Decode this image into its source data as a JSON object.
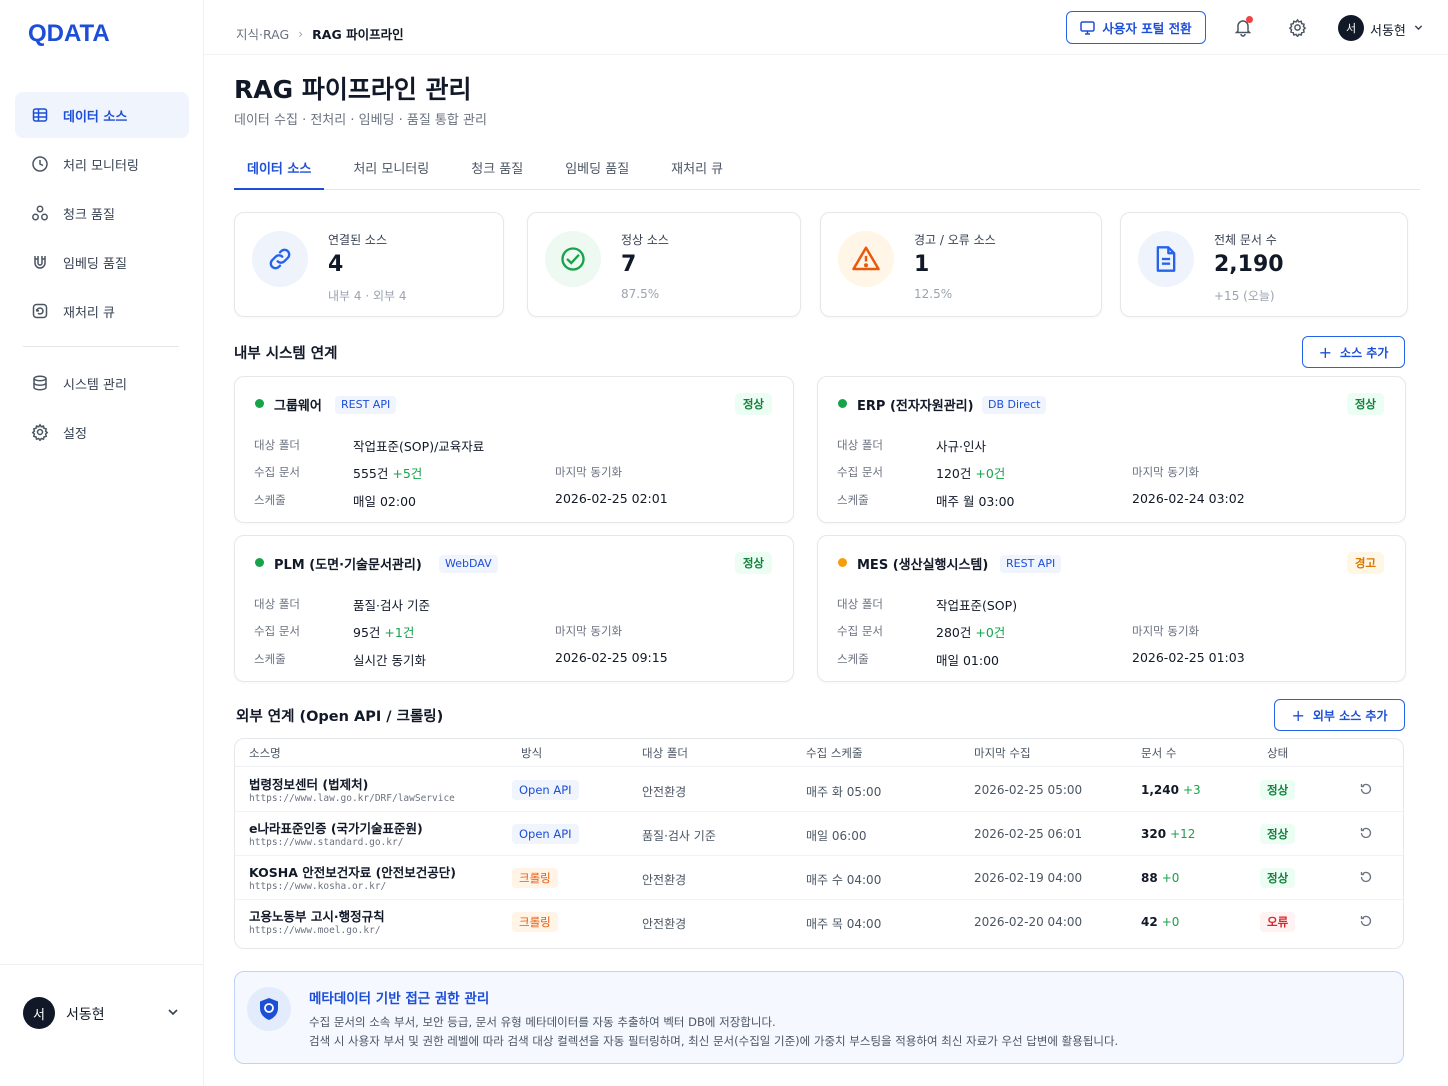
{
  "app": {
    "logo": "QDATA"
  },
  "sidebar": {
    "items": [
      {
        "label": "데이터 소스",
        "icon": "database-grid-icon"
      },
      {
        "label": "처리 모니터링",
        "icon": "clock-icon"
      },
      {
        "label": "청크 품질",
        "icon": "nodes-icon"
      },
      {
        "label": "임베딩 품질",
        "icon": "magnet-icon"
      },
      {
        "label": "재처리 큐",
        "icon": "retry-icon"
      },
      {
        "label": "시스템 관리",
        "icon": "database-icon"
      },
      {
        "label": "설정",
        "icon": "gear-icon"
      }
    ],
    "user": {
      "avatar": "서",
      "name": "서동현"
    }
  },
  "topbar": {
    "breadcrumb": [
      "지식·RAG",
      "RAG 파이프라인"
    ],
    "portal_label": "사용자 포털 전환",
    "user": {
      "avatar": "서",
      "name": "서동현"
    }
  },
  "header": {
    "title": "RAG 파이프라인 관리",
    "subtitle": "데이터 수집 · 전처리 · 임베딩 · 품질 통합 관리"
  },
  "tabs": [
    "데이터 소스",
    "처리 모니터링",
    "청크 품질",
    "임베딩 품질",
    "재처리 큐"
  ],
  "stats": [
    {
      "label": "연결된 소스",
      "value": "4",
      "sub": "내부 4 · 외부 4"
    },
    {
      "label": "정상 소스",
      "value": "7",
      "sub": "87.5%"
    },
    {
      "label": "경고 / 오류 소스",
      "value": "1",
      "sub": "12.5%"
    },
    {
      "label": "전체 문서 수",
      "value": "2,190",
      "sub": "+15 (오늘)"
    }
  ],
  "internal": {
    "title": "내부 시스템 연계",
    "add_label": "소스 추가",
    "field_labels": {
      "folder": "대상 폴더",
      "docs": "수집 문서",
      "schedule": "스케줄",
      "last_sync": "마지막 동기화"
    },
    "sources": [
      {
        "name": "그룹웨어",
        "type": "REST API",
        "status": "정상",
        "folder": "작업표준(SOP)/교육자료",
        "docs": "555건",
        "delta": "+5건",
        "schedule": "매일 02:00",
        "last_sync": "2026-02-25 02:01"
      },
      {
        "name": "ERP (전자자원관리)",
        "type": "DB Direct",
        "status": "정상",
        "folder": "사규·인사",
        "docs": "120건",
        "delta": "+0건",
        "schedule": "매주 월 03:00",
        "last_sync": "2026-02-24 03:02"
      },
      {
        "name": "PLM (도면·기술문서관리)",
        "type": "WebDAV",
        "status": "정상",
        "folder": "품질·검사 기준",
        "docs": "95건",
        "delta": "+1건",
        "schedule": "실시간 동기화",
        "last_sync": "2026-02-25 09:15"
      },
      {
        "name": "MES (생산실행시스템)",
        "type": "REST API",
        "status": "경고",
        "folder": "작업표준(SOP)",
        "docs": "280건",
        "delta": "+0건",
        "schedule": "매일 01:00",
        "last_sync": "2026-02-25 01:03"
      }
    ]
  },
  "external": {
    "title": "외부 연계 (Open API / 크롤링)",
    "add_label": "외부 소스 추가",
    "columns": [
      "소스명",
      "방식",
      "대상 폴더",
      "수집 스케줄",
      "마지막 수집",
      "문서 수",
      "상태"
    ],
    "rows": [
      {
        "name": "법령정보센터 (법제처)",
        "url": "https://www.law.go.kr/DRF/lawService",
        "method": "Open API",
        "folder": "안전환경",
        "schedule": "매주 화 05:00",
        "last": "2026-02-25 05:00",
        "docs": "1,240",
        "delta": "+3",
        "status": "정상"
      },
      {
        "name": "e나라표준인증 (국가기술표준원)",
        "url": "https://www.standard.go.kr/",
        "method": "Open API",
        "folder": "품질·검사 기준",
        "schedule": "매일 06:00",
        "last": "2026-02-25 06:01",
        "docs": "320",
        "delta": "+12",
        "status": "정상"
      },
      {
        "name": "KOSHA 안전보건자료 (안전보건공단)",
        "url": "https://www.kosha.or.kr/",
        "method": "크롤링",
        "folder": "안전환경",
        "schedule": "매주 수 04:00",
        "last": "2026-02-19 04:00",
        "docs": "88",
        "delta": "+0",
        "status": "정상"
      },
      {
        "name": "고용노동부 고시·행정규칙",
        "url": "https://www.moel.go.kr/",
        "method": "크롤링",
        "folder": "안전환경",
        "schedule": "매주 목 04:00",
        "last": "2026-02-20 04:00",
        "docs": "42",
        "delta": "+0",
        "status": "오류"
      }
    ]
  },
  "info": {
    "title": "메타데이터 기반 접근 권한 관리",
    "line1": "수집 문서의 소속 부서, 보안 등급, 문서 유형 메타데이터를 자동 추출하여 벡터 DB에 저장합니다.",
    "line2": "검색 시 사용자 부서 및 권한 레벨에 따라 검색 대상 컬렉션을 자동 필터링하며, 최신 문서(수집일 기준)에 가중치 부스팅을 적용하여 최신 자료가 우선 답변에 활용됩니다."
  },
  "colors": {
    "accent": "#1d4ed8",
    "ok": "#16a34a",
    "warn": "#f59e0b",
    "error": "#dc2626"
  }
}
